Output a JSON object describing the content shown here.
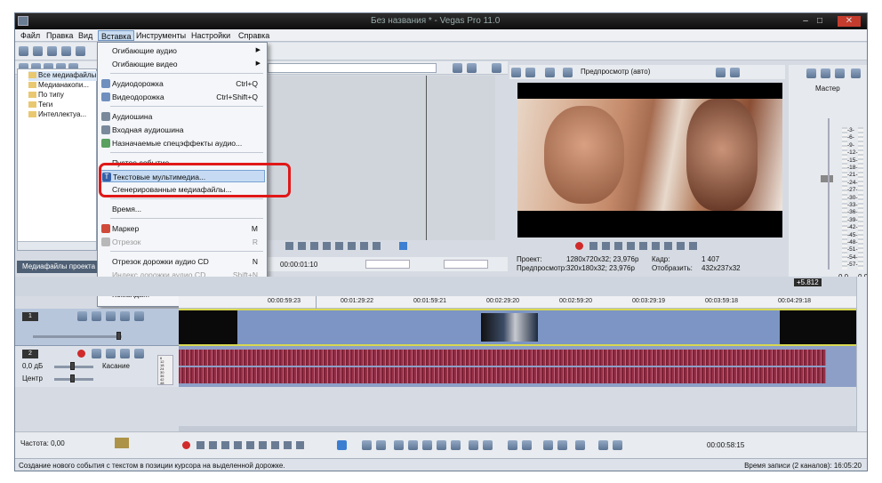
{
  "window": {
    "title": "Без названия * - Vegas Pro 11.0"
  },
  "menubar": {
    "items": [
      "Файл",
      "Правка",
      "Вид",
      "Вставка",
      "Инструменты",
      "Настройки",
      "Справка"
    ]
  },
  "explorer": {
    "tree": [
      "Все медиафайлы",
      "Медианакопи...",
      "По типу",
      "Теги",
      "Интеллектуа..."
    ],
    "tab_label": "Медиафайлы проекта"
  },
  "insert_menu": {
    "items": [
      {
        "label": "Огибающие аудио",
        "shortcut": "",
        "submenu": true
      },
      {
        "label": "Огибающие видео",
        "shortcut": "",
        "submenu": true
      },
      {
        "label": "Аудиодорожка",
        "shortcut": "Ctrl+Q"
      },
      {
        "label": "Видеодорожка",
        "shortcut": "Ctrl+Shift+Q"
      },
      {
        "label": "Аудиошина",
        "shortcut": ""
      },
      {
        "label": "Входная аудиошина",
        "shortcut": ""
      },
      {
        "label": "Назначаемые спецэффекты аудио...",
        "shortcut": ""
      },
      {
        "label": "Пустое событие",
        "shortcut": ""
      },
      {
        "label": "Текстовые мультимедиа...",
        "shortcut": ""
      },
      {
        "label": "Сгенерированные медиафайлы...",
        "shortcut": ""
      },
      {
        "label": "Время...",
        "shortcut": ""
      },
      {
        "label": "Маркер",
        "shortcut": "M"
      },
      {
        "label": "Отрезок",
        "shortcut": "R"
      },
      {
        "label": "Отрезок дорожки аудио CD",
        "shortcut": "N"
      },
      {
        "label": "Индекс дорожки аудио CD",
        "shortcut": "Shift+N"
      },
      {
        "label": "Команда...",
        "shortcut": "C"
      }
    ]
  },
  "preview": {
    "mode": "Предпросмотр (авто)",
    "project_label": "Проект:",
    "project_value": "1280x720x32; 23,976p",
    "preview_label": "Предпросмотр:",
    "preview_value": "320x180x32; 23,976p",
    "frame_label": "Кадр:",
    "frame_value": "1 407",
    "display_label": "Отобразить:",
    "display_value": "432x237x32"
  },
  "mixer": {
    "title": "Мастер",
    "scale": [
      "3",
      "6",
      "9",
      "12",
      "15",
      "18",
      "21",
      "24",
      "27",
      "30",
      "33",
      "36",
      "39",
      "42",
      "45",
      "48",
      "51",
      "54",
      "57"
    ],
    "left_value": "0.0",
    "right_value": "0.0",
    "delta": "+5.812"
  },
  "trimmer": {
    "timecode": "00:00:01:10"
  },
  "timeline": {
    "ruler": [
      "00:00:59:23",
      "00:01:29:22",
      "00:01:59:21",
      "00:02:29:20",
      "00:02:59:20",
      "00:03:29:19",
      "00:03:59:18",
      "00:04:29:18"
    ],
    "video_track_num": "1",
    "audio_track_num": "2",
    "volume": "0,0 дБ",
    "pan": "Центр",
    "fx_mode": "Касание",
    "audio_scale": [
      "6",
      "12",
      "18",
      "24",
      "30",
      "36",
      "42",
      "48"
    ],
    "cursor_time": "00:00:58:15"
  },
  "bottom": {
    "rate_label": "Частота: 0,00"
  },
  "status": {
    "message": "Создание нового события с текстом в позиции курсора на выделенной дорожке.",
    "record_time": "Время записи (2 каналов): 16:05:20"
  },
  "colors": {
    "highlight": "#c6dbf3",
    "redbox": "#e01818",
    "audio_wave": "#962f46",
    "video_track": "#7c95c4"
  }
}
